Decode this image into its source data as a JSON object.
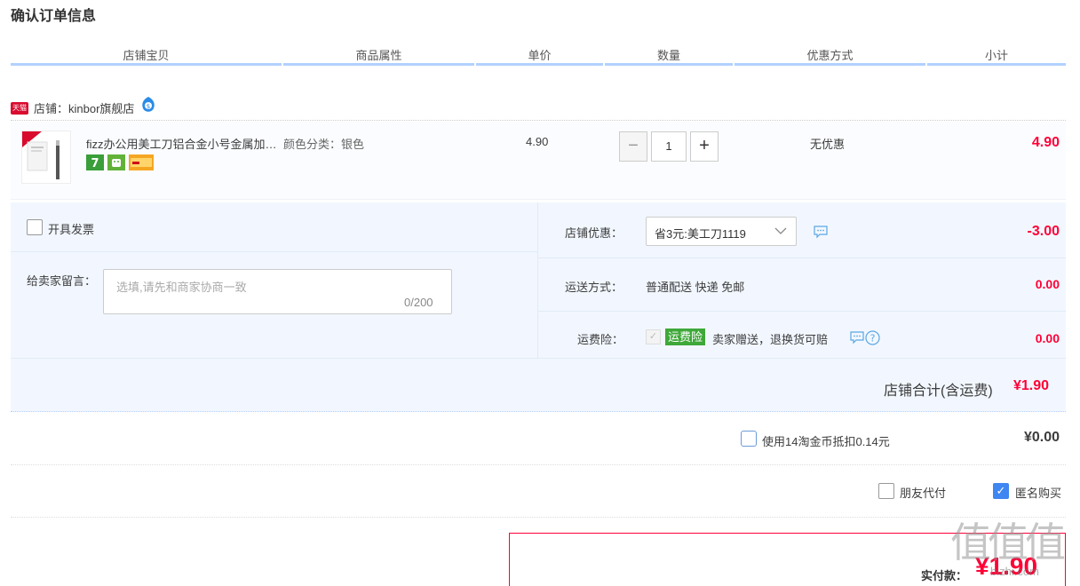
{
  "page": {
    "title": "确认订单信息"
  },
  "columns": [
    "店铺宝贝",
    "商品属性",
    "单价",
    "数量",
    "优惠方式",
    "小计"
  ],
  "shop": {
    "prefix": "店铺：",
    "name": "kinbor旗舰店",
    "badge": "天猫"
  },
  "item": {
    "title": "fizz办公用美工刀铝合金小号金属加长刀片",
    "attr": "颜色分类：银色",
    "price": "4.90",
    "quantity": "1",
    "promo": "无优惠",
    "subtotal": "4.90",
    "service_icons": [
      "7-day-return-icon",
      "android-service-icon",
      "credit-card-icon"
    ]
  },
  "invoice": {
    "label": "开具发票"
  },
  "message": {
    "label": "给卖家留言：",
    "placeholder": "选填,请先和商家协商一致",
    "counter": "0/200"
  },
  "shop_promo": {
    "label": "店铺优惠：",
    "selected": "省3元:美工刀1119",
    "amount": "-3.00"
  },
  "shipping": {
    "label": "运送方式：",
    "value": "普通配送 快递 免邮",
    "amount": "0.00"
  },
  "insurance": {
    "label": "运费险：",
    "badge": "运费险",
    "text": "卖家赠送，退换货可赔",
    "amount": "0.00"
  },
  "shop_total": {
    "label": "店铺合计(含运费)",
    "amount": "¥1.90"
  },
  "coins": {
    "text": "使用14淘金币抵扣0.14元",
    "amount": "¥0.00"
  },
  "friend_pay": {
    "label": "朋友代付"
  },
  "anonymous": {
    "label": "匿名购买"
  },
  "payment": {
    "label": "实付款：",
    "amount": "¥1.90"
  },
  "watermark": {
    "text": "值值值",
    "sub": "bizhi.com"
  },
  "colors": {
    "accent_red": "#ff0036",
    "accent_blue": "#b2d1ff",
    "panel_bg": "#f2f7ff",
    "insurance_green": "#3ea839"
  }
}
